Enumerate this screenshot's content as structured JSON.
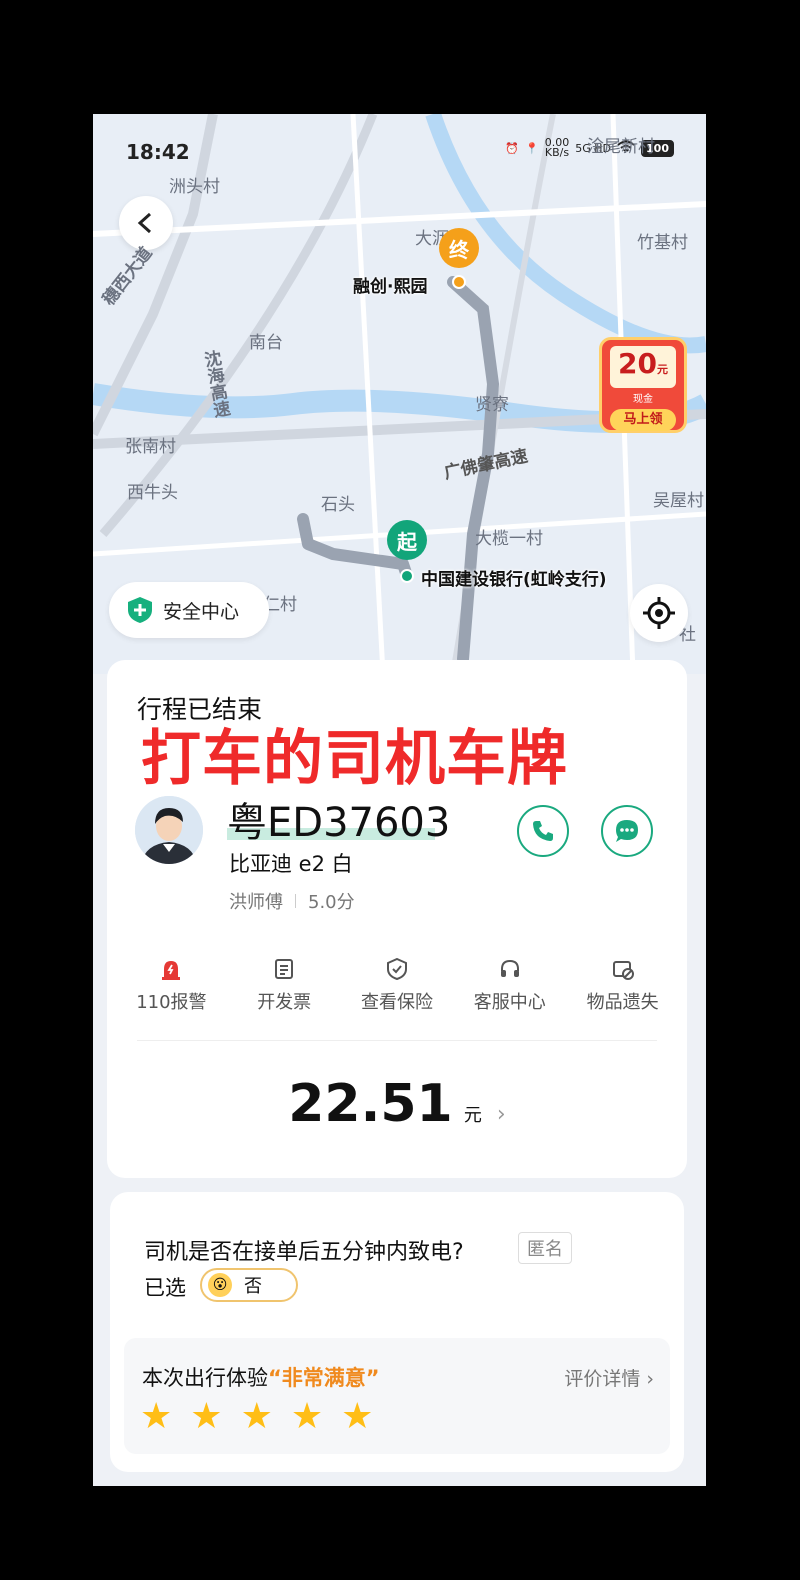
{
  "status_bar": {
    "time": "18:42",
    "speed": "0.00",
    "speed_unit": "KB/s",
    "network": "5G HD",
    "battery": "100"
  },
  "map": {
    "place_labels": [
      "洲头村",
      "大沥",
      "竹基村",
      "淦尾新村",
      "南台",
      "贤寮",
      "张南村",
      "西牛头",
      "石头",
      "大榄一村",
      "吴屋村",
      "仁村",
      "社"
    ],
    "road_labels": [
      "穗西大道",
      "沈海高速",
      "广佛肇高速"
    ],
    "destination": {
      "marker": "终",
      "name": "融创·熙园"
    },
    "origin": {
      "marker": "起",
      "name": "中国建设银行(虹岭支行)"
    },
    "promo": {
      "amount": "20",
      "unit": "元",
      "subtitle": "现金",
      "button": "马上领"
    },
    "safety_center": "安全中心"
  },
  "trip": {
    "status": "行程已结束",
    "overlay_title": "打车的司机车牌",
    "plate": "粤ED37603",
    "car_model": "比亚迪 e2  白",
    "driver_name": "洪师傅",
    "driver_rating": "5.0分",
    "actions": [
      {
        "label": "110报警",
        "icon": "alarm-icon"
      },
      {
        "label": "开发票",
        "icon": "invoice-icon"
      },
      {
        "label": "查看保险",
        "icon": "shield-check-icon"
      },
      {
        "label": "客服中心",
        "icon": "headset-icon"
      },
      {
        "label": "物品遗失",
        "icon": "lost-item-icon"
      }
    ],
    "fare": "22.51",
    "fare_unit": "元"
  },
  "feedback": {
    "question": "司机是否在接单后五分钟内致电?",
    "anonymous": "匿名",
    "selected_label": "已选",
    "selected_value": "否",
    "experience_prefix": "本次出行体验",
    "experience_value": "“非常满意”",
    "detail_link": "评价详情",
    "stars": 5
  },
  "colors": {
    "accent_green": "#1aa97f",
    "overlay_red": "#ef2a2a",
    "star": "#ffbe16",
    "end_pin": "#f5a01a",
    "start_pin": "#12a57a"
  }
}
